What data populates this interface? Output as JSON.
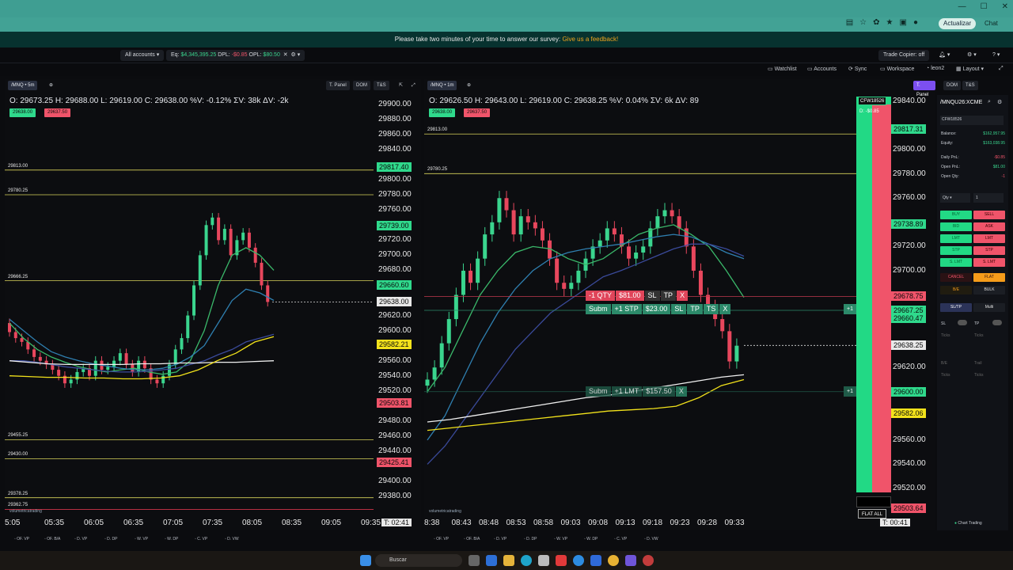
{
  "browser": {
    "update_label": "Actualizar",
    "chat_label": "Chat"
  },
  "survey": {
    "text": "Please take two minutes of your time to answer our survey:",
    "link": "Give us a feedback!"
  },
  "account_bar": {
    "accounts": "All accounts",
    "eq_label": "Eq:",
    "eq_value": "$4,345,395.25",
    "dpl_label": "DPL:",
    "dpl_value": "-$0.85",
    "opl_label": "OPL:",
    "opl_value": "$80.50",
    "trade_copier": "Trade Copier: off"
  },
  "nav": {
    "watchlist": "Watchlist",
    "accounts": "Accounts",
    "sync": "Sync",
    "workspace": "Workspace",
    "user": "leon2",
    "layout": "Layout"
  },
  "left_chart": {
    "symbol": "/MNQ",
    "timeframe": "5m",
    "buttons": [
      "T. Panel",
      "DOM",
      "T&S"
    ],
    "ohlc": "O: 29673.25  H: 29688.00  L: 29619.00  C: 29638.00  %V: -0.12%  ΣV: 38k  ΔV: -2k",
    "bid": "29638.00",
    "ask": "29637.50",
    "levels": [
      "29813.00",
      "29780.25",
      "29666.25",
      "29455.25",
      "29430.00",
      "29378.25",
      "29362.75"
    ],
    "y_ticks": [
      "29900.00",
      "29880.00",
      "29860.00",
      "29840.00",
      "29800.00",
      "29780.00",
      "29760.00",
      "29720.00",
      "29700.00",
      "29680.00",
      "29620.00",
      "29600.00",
      "29560.00",
      "29540.00",
      "29520.00",
      "29480.00",
      "29460.00",
      "29440.00",
      "29400.00",
      "29380.00"
    ],
    "y_tags": [
      "29817.40",
      "29739.00",
      "29660.60",
      "29638.00",
      "29582.21",
      "29503.81",
      "29425.41"
    ],
    "x_ticks": [
      "5:05",
      "05:35",
      "06:05",
      "06:35",
      "07:05",
      "07:35",
      "08:05",
      "08:35",
      "09:05",
      "09:35"
    ],
    "timer": "T: 02:41",
    "footer": [
      "OF. VP",
      "OF. B/A",
      "D. VP",
      "D. DP",
      "W. VP",
      "W. DP",
      "C. VP",
      "D. VW"
    ],
    "brand": "volumetricatrading"
  },
  "right_chart": {
    "symbol": "/MNQ",
    "timeframe": "1m",
    "buttons": [
      "T. Panel",
      "DOM",
      "T&S"
    ],
    "ohlc": "O: 29626.50  H: 29643.00  L: 29619.00  C: 29638.25  %V: 0.04%  ΣV: 6k  ΔV: 89",
    "bid": "29638.00",
    "ask": "29637.50",
    "levels": [
      "29813.00",
      "29780.25"
    ],
    "y_ticks": [
      "29840.00",
      "29800.00",
      "29780.00",
      "29760.00",
      "29720.00",
      "29700.00",
      "29620.00",
      "29560.00",
      "29540.00",
      "29520.00"
    ],
    "y_tags": [
      "29817.31",
      "29738.89",
      "29678.75",
      "29667.25",
      "29660.47",
      "29638.25",
      "29600.00",
      "29582.06",
      "29503.64"
    ],
    "x_ticks": [
      "8:38",
      "08:43",
      "08:48",
      "08:53",
      "08:58",
      "09:03",
      "09:08",
      "09:13",
      "09:18",
      "09:23",
      "09:28",
      "09:33"
    ],
    "timer": "T: 00:41",
    "account_tag": "CFW18526",
    "pnl_tag": "D: -$0.85",
    "flat_all": "FLAT ALL",
    "order_tp": [
      "-1 QTY",
      "$81.00",
      "SL",
      "TP",
      "X"
    ],
    "order_stp": [
      "Subm",
      "+1 STP",
      "$23.00",
      "SL",
      "TP",
      "TS",
      "X"
    ],
    "order_lmt": [
      "Subm",
      "+1 LMT",
      "$157.50",
      "X"
    ],
    "plus_one": "+1",
    "footer": [
      "OF. VP",
      "OF. B/A",
      "D. VP",
      "D. DP",
      "W. VP",
      "W. DP",
      "C. VP",
      "D. VW"
    ],
    "brand": "volumetricatrading"
  },
  "side_panel": {
    "symbol": "/MNQU26:XCME",
    "account": "CFW18526",
    "balance_label": "Balance:",
    "balance": "$162,957.95",
    "equity_label": "Equity:",
    "equity": "$163,038.95",
    "daily_pnl_label": "Daily PnL:",
    "daily_pnl": "-$0.85",
    "open_pnl_label": "Open PnL:",
    "open_pnl": "$81.00",
    "open_qty_label": "Open Qty:",
    "open_qty": "-1",
    "qty_label": "Qty",
    "qty_value": "1",
    "buy": "BUY",
    "sell": "SELL",
    "bid": "BID",
    "ask": "ASK",
    "lmt": "LMT",
    "stp": "STP",
    "slmt": "S. LMT",
    "cancel": "CANCEL",
    "flat": "FLAT",
    "be": "B/E",
    "bulk": "BULK",
    "sltp": "SL/TP",
    "multi": "Multi",
    "sl": "SL",
    "tp": "TP",
    "ticks": "Ticks",
    "be_label": "B/E",
    "trail": "Trail",
    "chart_trading": "Chart Trading"
  },
  "taskbar": {
    "search": "Buscar"
  },
  "colors": {
    "accent_green": "#2fd98c",
    "accent_red": "#f0546a",
    "yellow": "#f2e21b"
  }
}
